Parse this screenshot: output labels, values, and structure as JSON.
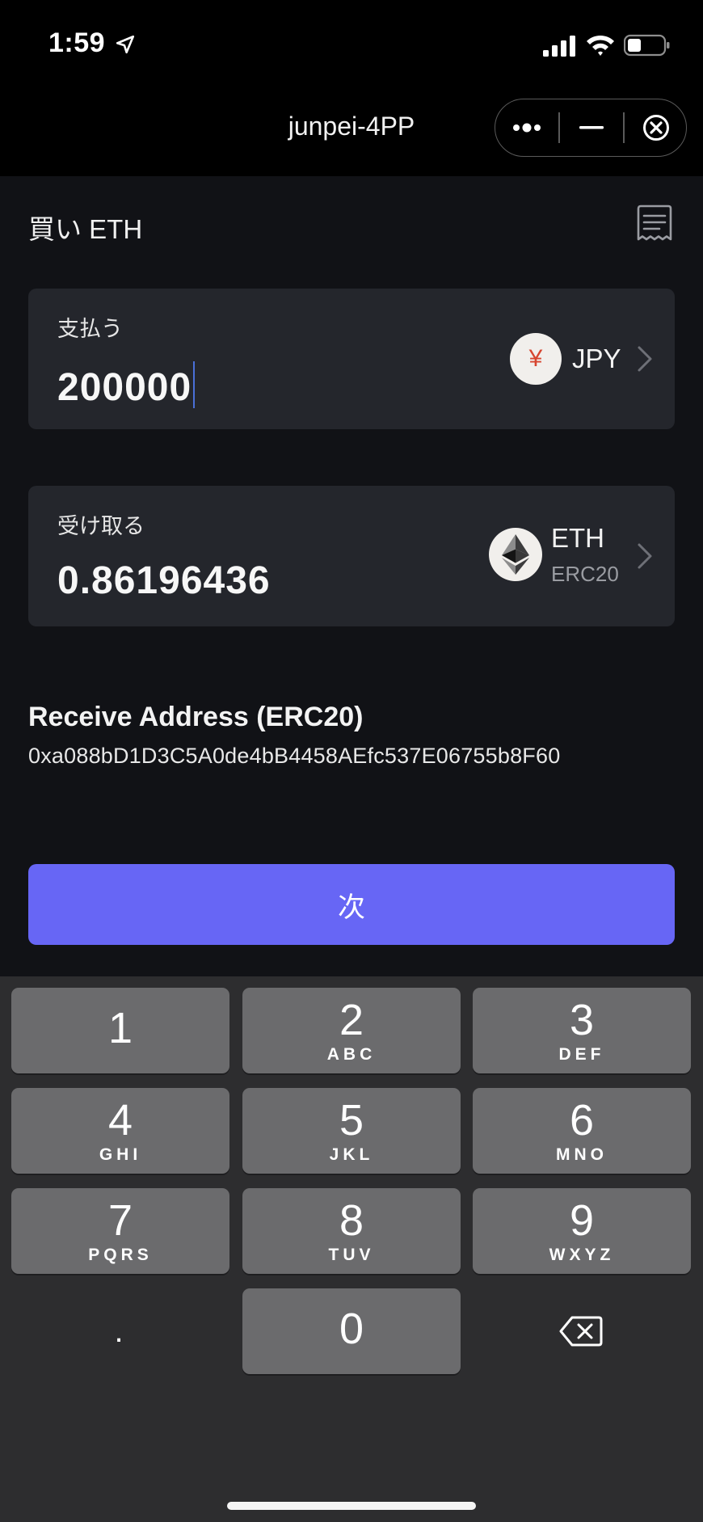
{
  "status_bar": {
    "time": "1:59"
  },
  "nav": {
    "title": "junpei-4PP",
    "more_icon": "more-dots-icon",
    "minimize_icon": "minimize-icon",
    "close_icon": "close-circle-icon"
  },
  "page": {
    "title": "買い ETH",
    "history_icon": "receipt-icon"
  },
  "pay": {
    "label": "支払う",
    "amount": "200000",
    "currency_symbol": "¥",
    "currency": "JPY"
  },
  "receive": {
    "label": "受け取る",
    "amount": "0.86196436",
    "currency": "ETH",
    "network": "ERC20"
  },
  "address": {
    "title": "Receive Address (ERC20)",
    "value": "0xa088bD1D3C5A0de4bB4458AEfc537E06755b8F60"
  },
  "next_button": {
    "label": "次"
  },
  "keypad": {
    "keys": [
      {
        "num": "1",
        "letters": ""
      },
      {
        "num": "2",
        "letters": "ABC"
      },
      {
        "num": "3",
        "letters": "DEF"
      },
      {
        "num": "4",
        "letters": "GHI"
      },
      {
        "num": "5",
        "letters": "JKL"
      },
      {
        "num": "6",
        "letters": "MNO"
      },
      {
        "num": "7",
        "letters": "PQRS"
      },
      {
        "num": "8",
        "letters": "TUV"
      },
      {
        "num": "9",
        "letters": "WXYZ"
      },
      {
        "num": "0",
        "letters": ""
      }
    ],
    "decimal": ".",
    "delete_icon": "backspace-icon"
  },
  "colors": {
    "accent": "#6766f5",
    "card": "#24262c",
    "background": "#111216",
    "key": "#6b6b6d",
    "yen": "#d6452f"
  }
}
